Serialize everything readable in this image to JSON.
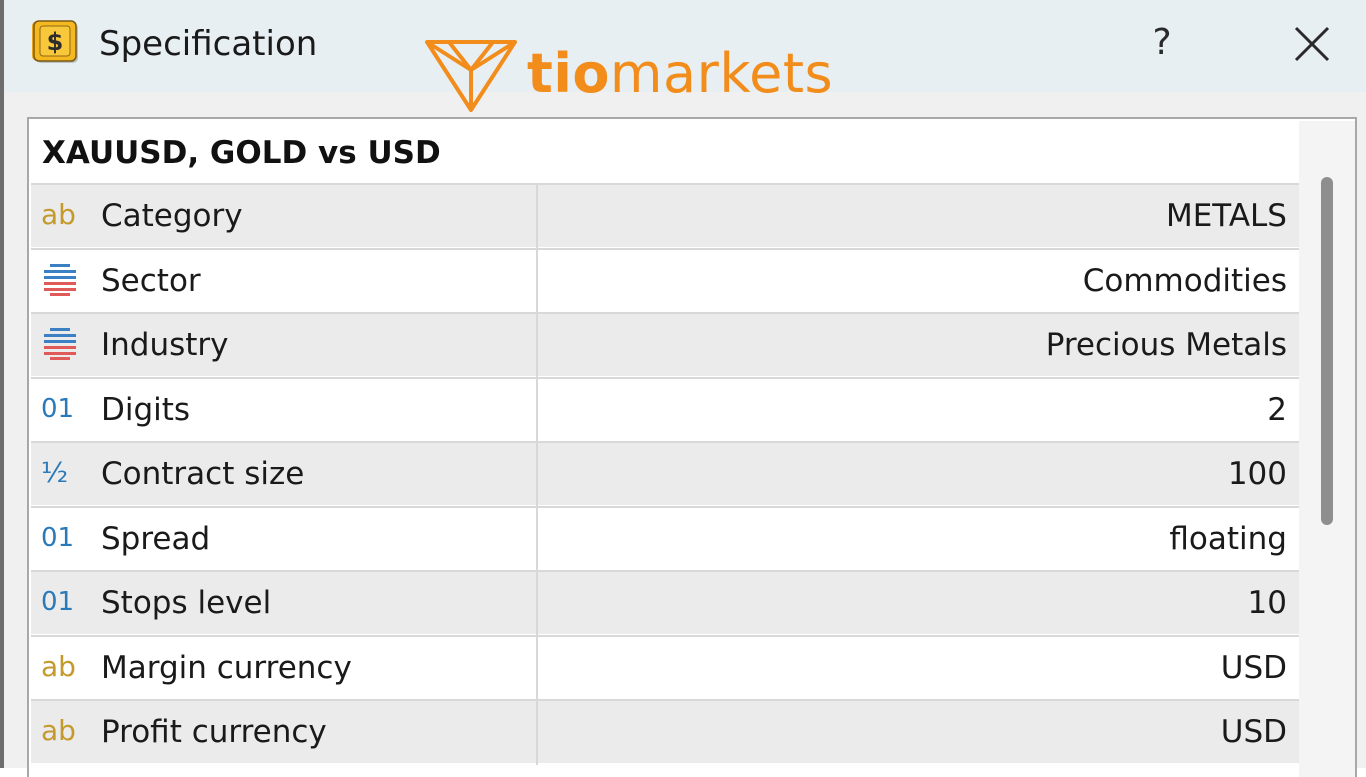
{
  "window": {
    "title": "Specification",
    "help_label": "?"
  },
  "brand": {
    "name_bold": "tio",
    "name_light": "markets",
    "color": "#f28c1b"
  },
  "symbol": {
    "heading": "XAUUSD, GOLD vs USD"
  },
  "properties": [
    {
      "icon": "text-type-icon",
      "icon_glyph": "ab",
      "label": "Category",
      "value": "METALS"
    },
    {
      "icon": "list-type-icon",
      "icon_glyph": "",
      "label": "Sector",
      "value": "Commodities"
    },
    {
      "icon": "list-type-icon",
      "icon_glyph": "",
      "label": "Industry",
      "value": "Precious Metals"
    },
    {
      "icon": "integer-type-icon",
      "icon_glyph": "01",
      "label": "Digits",
      "value": "2"
    },
    {
      "icon": "fraction-type-icon",
      "icon_glyph": "½",
      "label": "Contract size",
      "value": "100"
    },
    {
      "icon": "integer-type-icon",
      "icon_glyph": "01",
      "label": "Spread",
      "value": "floating"
    },
    {
      "icon": "integer-type-icon",
      "icon_glyph": "01",
      "label": "Stops level",
      "value": "10"
    },
    {
      "icon": "text-type-icon",
      "icon_glyph": "ab",
      "label": "Margin currency",
      "value": "USD"
    },
    {
      "icon": "text-type-icon",
      "icon_glyph": "ab",
      "label": "Profit currency",
      "value": "USD"
    }
  ],
  "colors": {
    "text_icon": "#c49a2c",
    "number_icon": "#2a79b9",
    "list_icon_blue": "#3b7fc4",
    "list_icon_red": "#e05a5a"
  }
}
